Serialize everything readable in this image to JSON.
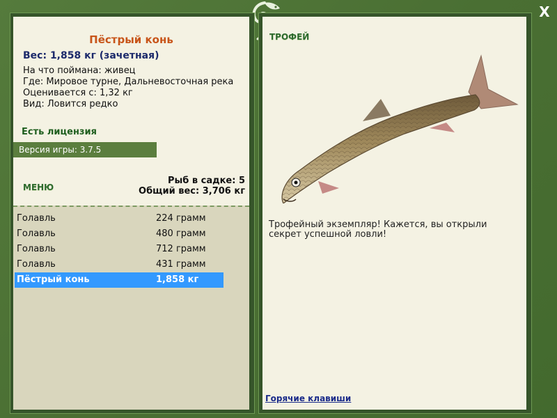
{
  "fish": {
    "title": "Пёстрый конь",
    "weight_line": "Вес: 1,858 кг (зачетная)",
    "caught_on": "На что поймана: живец",
    "where": "Где: Мировое турне, Дальневосточная река",
    "valued_from": "Оценивается с: 1,32 кг",
    "kind": "Вид: Ловится редко"
  },
  "license": "Есть лицензия",
  "version": "Версия игры: 3.7.5",
  "menu_label": "МЕНЮ",
  "stats": {
    "fish_in_keepnet": "Рыб в садке: 5",
    "total_weight": "Общий вес: 3,706 кг"
  },
  "catch": [
    {
      "name": "Голавль",
      "weight": "224 грамм"
    },
    {
      "name": "Голавль",
      "weight": "480 грамм"
    },
    {
      "name": "Голавль",
      "weight": "712 грамм"
    },
    {
      "name": "Голавль",
      "weight": "431 грамм"
    },
    {
      "name": "Пёстрый конь",
      "weight": "1,858 кг",
      "selected": true
    }
  ],
  "trophy_label": "ТРОФЕЙ",
  "description": "Трофейный экземпляр! Кажется, вы открыли секрет успешной ловли!",
  "hotkeys_link": "Горячие клавиши",
  "close_label": "X",
  "icons": {
    "close": "close-icon",
    "logo": "chameleon-logo-icon"
  },
  "colors": {
    "frame": "#4b7034",
    "panel": "#f4f2e3",
    "title": "#c8551a",
    "selected_row": "#3399ff"
  }
}
